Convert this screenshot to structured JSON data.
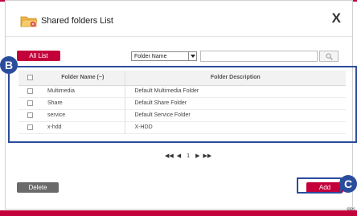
{
  "dialog": {
    "title": "Shared folders List",
    "close_label": "X"
  },
  "toolbar": {
    "all_list_label": "All List",
    "filter_selected": "Folder Name",
    "search_value": ""
  },
  "table": {
    "headers": [
      "Folder Name (~)",
      "Folder Description"
    ],
    "rows": [
      {
        "name": "Multimedia",
        "description": "Default Multimedia Folder"
      },
      {
        "name": "Share",
        "description": "Default Share Folder"
      },
      {
        "name": "service",
        "description": "Default Service Folder"
      },
      {
        "name": "x-hdd",
        "description": "X-HDD"
      }
    ]
  },
  "pager": {
    "first": "◀◀",
    "prev": "◀",
    "current_page": "1",
    "next": "▶",
    "last": "▶▶"
  },
  "footer": {
    "delete_label": "Delete",
    "add_label": "Add",
    "close_text": "clos"
  },
  "callouts": {
    "b": "B",
    "c": "C"
  },
  "colors": {
    "accent": "#c4003a",
    "callout": "#2a4c9c",
    "delete_button": "#6a6a6a"
  },
  "icons": {
    "title_icon": "shared-folder-icon",
    "dropdown": "dropdown-arrow-icon",
    "search": "search-icon"
  }
}
